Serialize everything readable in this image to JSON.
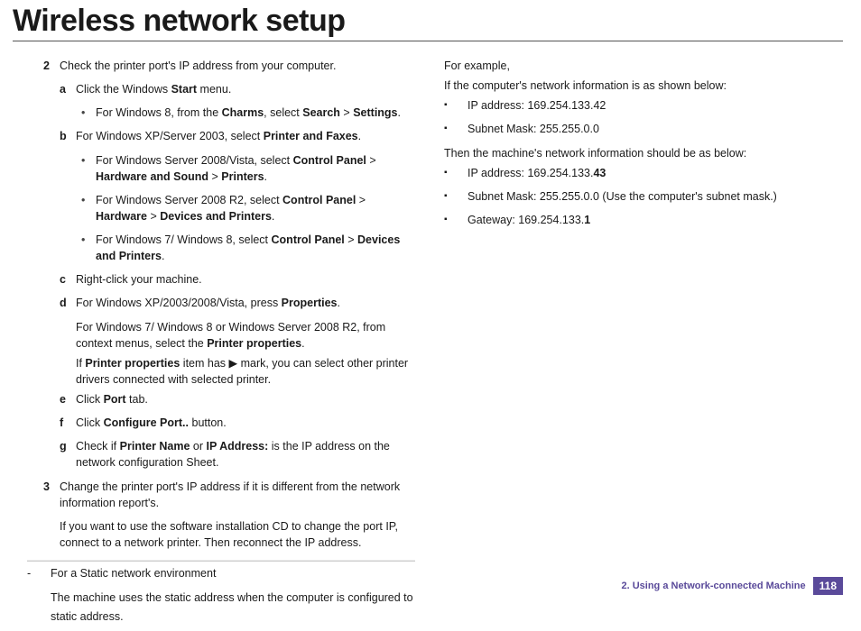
{
  "title": "Wireless network setup",
  "left": {
    "step2": {
      "num": "2",
      "text": "Check the printer port's IP address from your computer."
    },
    "a": {
      "let": "a",
      "text_pre": "Click the Windows ",
      "b1": "Start",
      "text_post": " menu."
    },
    "a_sub1": {
      "pre": "For Windows 8, from the ",
      "b1": "Charms",
      "mid1": ", select ",
      "b2": "Search",
      "gt": " > ",
      "b3": "Settings",
      "post": "."
    },
    "b": {
      "let": "b",
      "pre": "For Windows XP/Server 2003, select ",
      "b1": "Printer and Faxes",
      "post": "."
    },
    "b_sub1": {
      "pre": "For Windows Server 2008/Vista, select ",
      "b1": "Control Panel",
      "gt1": " > ",
      "b2": "Hardware and Sound",
      "gt2": " > ",
      "b3": "Printers",
      "post": "."
    },
    "b_sub2": {
      "pre": "For Windows Server 2008 R2, select ",
      "b1": "Control Panel",
      "gt1": " > ",
      "b2": "Hardware",
      "gt2": " > ",
      "b3": "Devices and Printers",
      "post": "."
    },
    "b_sub3": {
      "pre": "For Windows 7/ Windows 8, select ",
      "b1": "Control Panel",
      "gt1": " > ",
      "b2": "Devices and Printers",
      "post": "."
    },
    "c": {
      "let": "c",
      "text": "Right-click your machine."
    },
    "d": {
      "let": "d",
      "pre": "For Windows XP/2003/2008/Vista, press ",
      "b1": "Properties",
      "post": "."
    },
    "d_line2": {
      "pre": "For Windows 7/ Windows 8 or Windows Server 2008 R2, from context menus, select the ",
      "b1": "Printer properties",
      "post": "."
    },
    "d_line3": {
      "pre": "If ",
      "b1": "Printer properties",
      "mid": " item has ▶ mark, you can select other printer drivers connected with selected printer."
    },
    "e": {
      "let": "e",
      "pre": "Click ",
      "b1": "Port",
      "post": " tab."
    },
    "f": {
      "let": "f",
      "pre": "Click ",
      "b1": "Configure Port..",
      "post": " button."
    },
    "g": {
      "let": "g",
      "pre": "Check if ",
      "b1": "Printer Name",
      "mid": " or ",
      "b2": "IP Address:",
      "post": " is the IP address on the network configuration Sheet."
    },
    "step3": {
      "num": "3",
      "text": "Change the printer port's IP address if it is different from the network information report's."
    },
    "step3_body": "If you want to use the software installation CD to change the port IP, connect to a network printer. Then reconnect the IP address.",
    "dash": {
      "dash": "-",
      "text": "For a Static network environment"
    },
    "static_body": "The machine uses the static address when the computer is configured to static address."
  },
  "right": {
    "p1": "For example,",
    "p2": "If the computer's network information is as shown below:",
    "ip1": "IP address: 169.254.133.42",
    "mask1": "Subnet Mask: 255.255.0.0",
    "p3": "Then the machine's network information should be as below:",
    "ip2_pre": "IP address: 169.254.133.",
    "ip2_b": "43",
    "mask2": "Subnet Mask: 255.255.0.0 (Use the computer's subnet mask.)",
    "gw_pre": "Gateway: 169.254.133.",
    "gw_b": "1"
  },
  "footer": {
    "chapter": "2.  Using a Network-connected Machine",
    "page": "118"
  }
}
